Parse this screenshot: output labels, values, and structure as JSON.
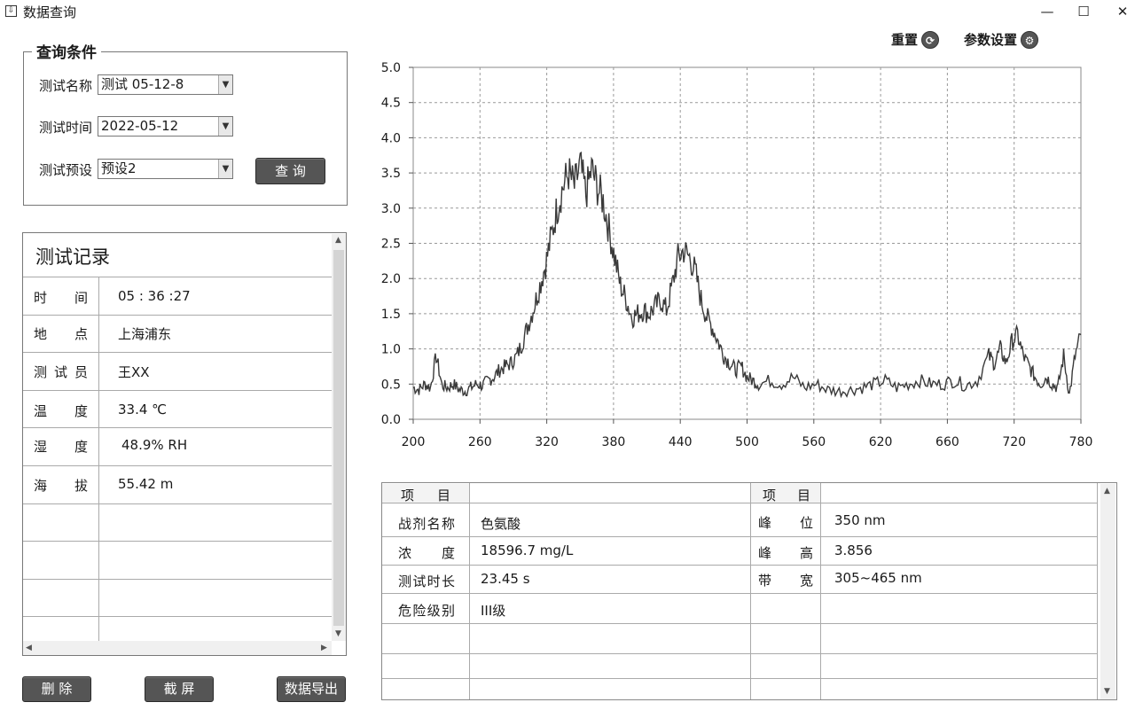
{
  "window": {
    "title": "数据查询",
    "minimize": "—",
    "maximize": "☐",
    "close": "✕"
  },
  "toolbar": {
    "reset_label": "重置",
    "reset_icon": "reset-icon",
    "settings_label": "参数设置",
    "settings_icon": "gear-icon"
  },
  "query": {
    "group_title": "查询条件",
    "name_label": "测试名称",
    "name_value": "测试 05-12-8",
    "time_label": "测试时间",
    "time_value": "2022-05-12",
    "preset_label": "测试预设",
    "preset_value": "预设2",
    "query_button": "查 询"
  },
  "records": {
    "title": "测试记录",
    "rows": [
      {
        "label": "时间",
        "value": "05 : 36 :27"
      },
      {
        "label": "地点",
        "value": "上海浦东"
      },
      {
        "label": "测试员",
        "value": "王XX"
      },
      {
        "label": "温度",
        "value": "33.4 ℃"
      },
      {
        "label": "湿度",
        "value": "48.9% RH"
      },
      {
        "label": "海拔",
        "value": "55.42 m"
      }
    ]
  },
  "results": {
    "header_left": "项 目",
    "header_right": "项 目",
    "left_rows": [
      {
        "label": "战剂名称",
        "value": "色氨酸"
      },
      {
        "label": "浓度",
        "value": "18596.7 mg/L"
      },
      {
        "label": "测试时长",
        "value": "23.45 s"
      },
      {
        "label": "危险级别",
        "value": "III级"
      }
    ],
    "right_rows": [
      {
        "label": "峰位",
        "value": "350 nm"
      },
      {
        "label": "峰高",
        "value": "3.856"
      },
      {
        "label": "带宽",
        "value": "305~465 nm"
      }
    ]
  },
  "buttons": {
    "delete": "删 除",
    "screenshot": "截 屏",
    "export": "数据导出"
  },
  "chart_data": {
    "type": "line",
    "title": "",
    "xlabel": "",
    "ylabel": "",
    "xlim": [
      200,
      780
    ],
    "ylim": [
      0,
      5.0
    ],
    "xticks": [
      200,
      260,
      320,
      380,
      440,
      500,
      560,
      620,
      660,
      720,
      780
    ],
    "yticks": [
      "0.0",
      "0.5",
      "1.0",
      "1.5",
      "2.0",
      "2.5",
      "3.0",
      "3.5",
      "4.0",
      "4.5",
      "5.0"
    ],
    "grid": true,
    "line_color": "#3a3a3a",
    "series": [
      {
        "x": [
          200,
          205,
          210,
          215,
          220,
          225,
          230,
          235,
          240,
          245,
          250,
          255,
          260,
          265,
          270,
          275,
          280,
          285,
          290,
          295,
          300,
          305,
          310,
          315,
          320,
          325,
          330,
          335,
          340,
          345,
          350,
          355,
          360,
          365,
          370,
          375,
          380,
          385,
          390,
          395,
          400,
          405,
          410,
          415,
          420,
          425,
          430,
          435,
          440,
          445,
          450,
          455,
          460,
          465,
          470,
          475,
          480,
          485,
          490,
          495,
          500,
          510,
          520,
          530,
          540,
          550,
          560,
          570,
          580,
          590,
          600,
          610,
          620,
          630,
          640,
          650,
          660,
          670,
          680,
          690,
          700,
          705,
          710,
          715,
          720,
          725,
          730,
          735,
          740,
          745,
          750,
          755,
          760,
          765,
          770,
          775,
          780
        ],
        "y": [
          0.45,
          0.42,
          0.5,
          0.45,
          0.9,
          0.48,
          0.45,
          0.5,
          0.42,
          0.4,
          0.45,
          0.5,
          0.48,
          0.55,
          0.6,
          0.7,
          0.75,
          0.8,
          0.9,
          1.1,
          1.35,
          1.6,
          1.9,
          2.2,
          2.6,
          3.0,
          3.3,
          3.5,
          3.3,
          3.6,
          3.2,
          3.55,
          3.3,
          3.1,
          2.7,
          2.3,
          1.9,
          1.7,
          1.45,
          1.5,
          1.55,
          1.5,
          1.6,
          1.7,
          1.55,
          1.9,
          2.3,
          2.4,
          2.3,
          2.1,
          1.7,
          1.45,
          1.3,
          1.1,
          0.9,
          0.8,
          0.7,
          0.75,
          0.6,
          0.55,
          0.5,
          0.55,
          0.5,
          0.6,
          0.45,
          0.5,
          0.42,
          0.4,
          0.42,
          0.45,
          0.5,
          0.55,
          0.45,
          0.5,
          0.55,
          0.5,
          0.5,
          0.55,
          0.48,
          0.55,
          0.9,
          0.8,
          1.0,
          0.8,
          1.1,
          1.2,
          0.9,
          0.75,
          0.6,
          0.5,
          0.6,
          0.5,
          0.45,
          0.9,
          0.35,
          0.9,
          1.2
        ]
      }
    ]
  }
}
